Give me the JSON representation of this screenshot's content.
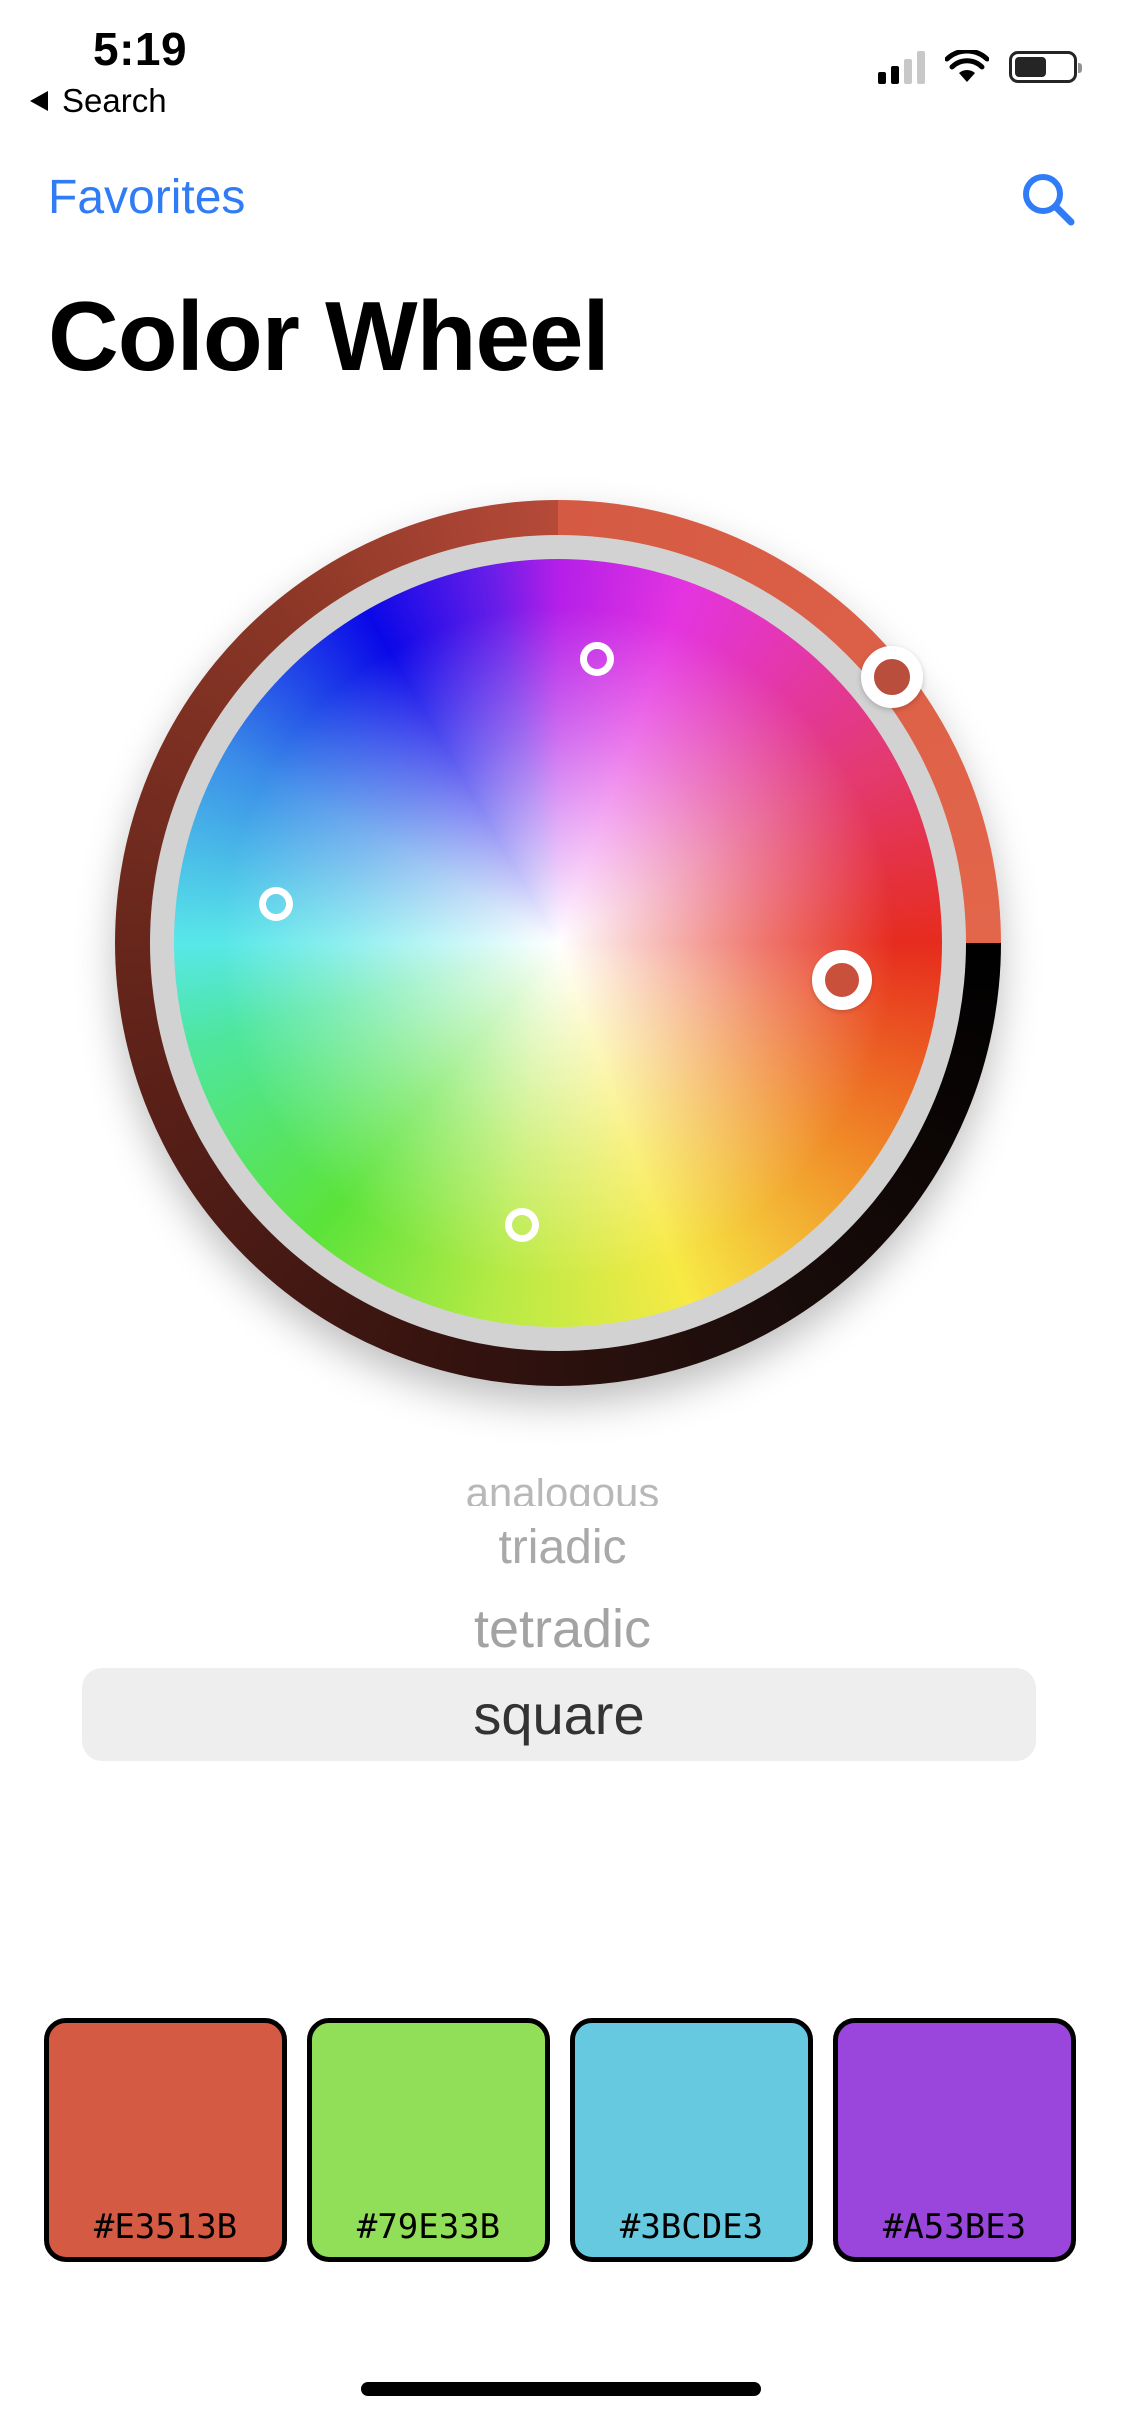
{
  "status_bar": {
    "time": "5:19",
    "back_label": "Search"
  },
  "nav": {
    "left_link": "Favorites",
    "search_icon": "search-icon",
    "accent_color": "#2f7cf6"
  },
  "page": {
    "title": "Color Wheel"
  },
  "picker": {
    "options": [
      "analogous",
      "triadic",
      "tetradic",
      "square"
    ],
    "selected": "square"
  },
  "swatches": [
    {
      "hex": "#E3513B",
      "color": "#d55a43"
    },
    {
      "hex": "#79E33B",
      "color": "#91df58"
    },
    {
      "hex": "#3BCDE3",
      "color": "#67c9df"
    },
    {
      "hex": "#A53BE3",
      "color": "#9a45db"
    }
  ]
}
